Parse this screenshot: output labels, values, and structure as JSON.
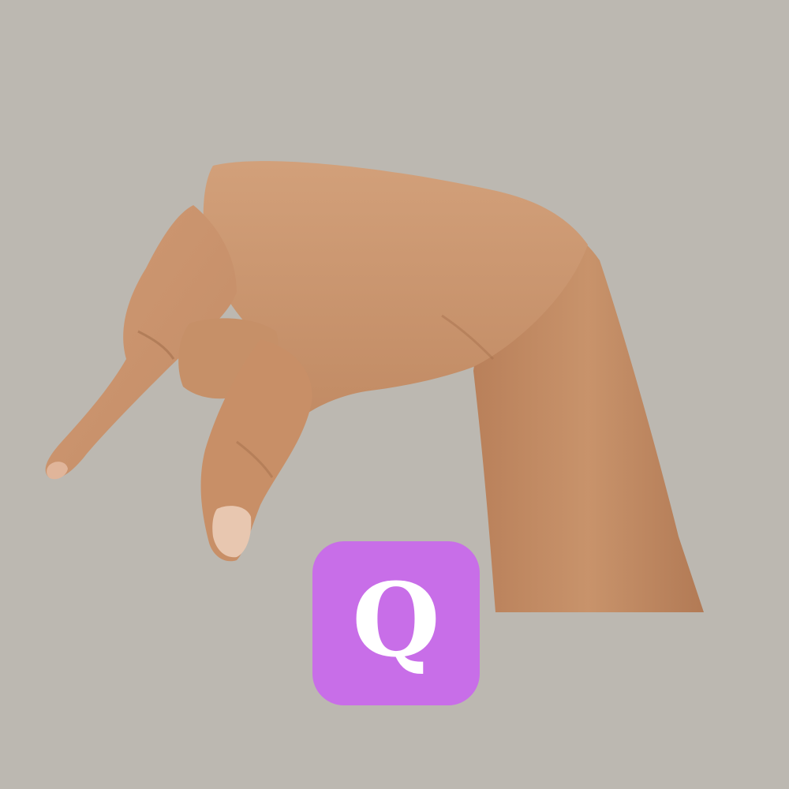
{
  "background_color": "#bcb8b1",
  "photo": {
    "subject": "hand-sign-q",
    "skin_tone": "#c8936b"
  },
  "badge": {
    "letter": "Q",
    "background_color": "#c86ee8",
    "text_color": "#ffffff"
  }
}
